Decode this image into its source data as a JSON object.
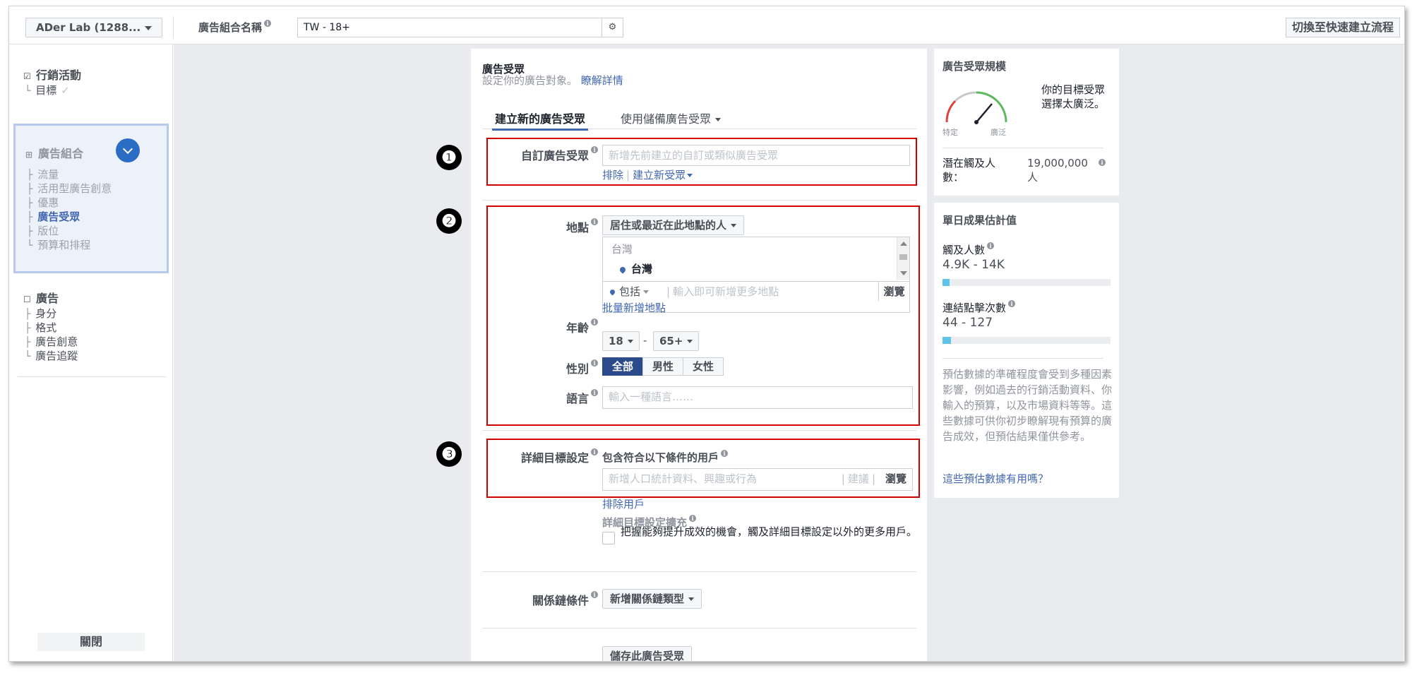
{
  "topbar": {
    "account": "ADer Lab (1288...",
    "adset_name_label": "廣告組合名稱",
    "adset_name_value": "TW - 18+",
    "switch_button": "切換至快速建立流程"
  },
  "sidebar": {
    "campaign": {
      "label": "行銷活動",
      "items": [
        "目標"
      ]
    },
    "adset": {
      "label": "廣告組合",
      "items": [
        "流量",
        "活用型廣告創意",
        "優惠",
        "廣告受眾",
        "版位",
        "預算和排程"
      ],
      "active": "廣告受眾"
    },
    "ad": {
      "label": "廣告",
      "items": [
        "身分",
        "格式",
        "廣告創意",
        "廣告追蹤"
      ]
    },
    "close_button": "關閉"
  },
  "audience": {
    "title": "廣告受眾",
    "subtitle": "設定你的廣告對象。",
    "learn_more": "瞭解詳情",
    "tabs": {
      "create": "建立新的廣告受眾",
      "saved": "使用儲備廣告受眾"
    },
    "custom_audience": {
      "label": "自訂廣告受眾",
      "placeholder": "新增先前建立的自訂或類似廣告受眾",
      "exclude": "排除",
      "create_new": "建立新受眾"
    },
    "location": {
      "label": "地點",
      "type": "居住或最近在此地點的人",
      "country_group": "台灣",
      "selected": "台灣",
      "include": "包括",
      "placeholder": "輸入即可新增更多地點",
      "browse": "瀏覽",
      "bulk_add": "批量新增地點"
    },
    "age": {
      "label": "年齡",
      "min": "18",
      "max": "65+",
      "dash": "-"
    },
    "gender": {
      "label": "性別",
      "options": [
        "全部",
        "男性",
        "女性"
      ],
      "selected": "全部"
    },
    "language": {
      "label": "語言",
      "placeholder": "輸入一種語言……"
    },
    "detailed": {
      "label": "詳細目標設定",
      "include_label": "包含符合以下條件的用戶",
      "placeholder": "新增人口統計資料、興趣或行為",
      "suggest": "建議",
      "browse": "瀏覽",
      "exclude": "排除用戶",
      "expansion_title": "詳細目標設定擴充",
      "expansion_text": "把握能夠提升成效的機會，觸及詳細目標設定以外的更多用戶。"
    },
    "connections": {
      "label": "關係鏈條件",
      "button": "新增關係鏈類型"
    },
    "save_button": "儲存此廣告受眾"
  },
  "audience_size": {
    "title": "廣告受眾規模",
    "gauge_text": "你的目標受眾選擇太廣泛。",
    "gauge_left": "特定",
    "gauge_right": "廣泛",
    "potential_reach_label": "潛在觸及人數：",
    "potential_reach_value": "19,000,000 人"
  },
  "daily_results": {
    "title": "單日成果估計值",
    "reach_label": "觸及人數",
    "reach_value": "4.9K - 14K",
    "reach_fraction": 0.04,
    "clicks_label": "連結點擊次數",
    "clicks_value": "44 - 127",
    "clicks_fraction": 0.05,
    "note": "預估數據的準確程度會受到多種因素影響，例如過去的行銷活動資料、你輸入的預算，以及市場資料等等。這些數據可供你初步瞭解現有預算的廣告成效，但預估結果僅供參考。",
    "feedback_link": "這些預估數據有用嗎？"
  },
  "callouts": [
    "❶",
    "❷",
    "❸"
  ],
  "colors": {
    "accent": "#4267b2",
    "highlight": "#d40000",
    "gauge_red": "#e04040",
    "gauge_green": "#5fb85f",
    "bar": "#5fc3ea"
  }
}
